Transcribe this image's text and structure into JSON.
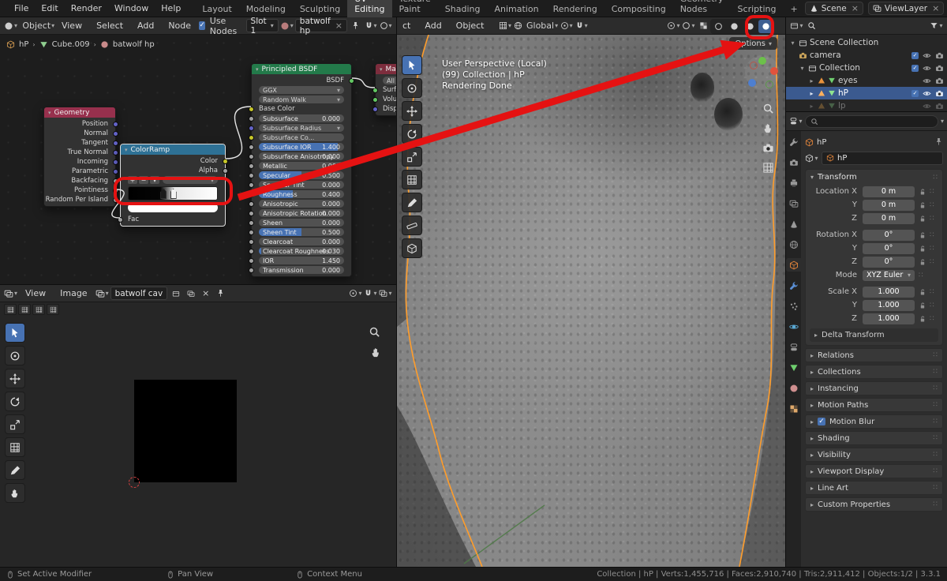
{
  "topbar": {
    "menus": [
      "File",
      "Edit",
      "Render",
      "Window",
      "Help"
    ],
    "workspaces": [
      "Layout",
      "Modeling",
      "Sculpting",
      "UV Editing",
      "Texture Paint",
      "Shading",
      "Animation",
      "Rendering",
      "Compositing",
      "Geometry Nodes",
      "Scripting"
    ],
    "add_tab": "+",
    "scene": "Scene",
    "viewlayer": "ViewLayer"
  },
  "shader": {
    "mode": "Object",
    "menus": [
      "View",
      "Select",
      "Add",
      "Node"
    ],
    "use_nodes": "Use Nodes",
    "slot": "Slot 1",
    "material": "batwolf hp",
    "breadcrumb": [
      "hP",
      "Cube.009",
      "batwolf hp"
    ],
    "geometry": {
      "title": "Geometry",
      "outputs": [
        "Position",
        "Normal",
        "Tangent",
        "True Normal",
        "Incoming",
        "Parametric",
        "Backfacing",
        "Pointiness",
        "Random Per Island"
      ]
    },
    "colorramp": {
      "title": "ColorRamp",
      "outputs": [
        "Color",
        "Alpha"
      ],
      "input": "Fac"
    },
    "principled": {
      "title": "Principled BSDF",
      "output": "BSDF",
      "dd1": "GGX",
      "dd2": "Random Walk",
      "base": "Base Color",
      "rows": [
        {
          "label": "Subsurface",
          "value": "0.000"
        },
        {
          "label": "Subsurface Radius",
          "value": ""
        },
        {
          "label": "Subsurface Co...",
          "value": ""
        },
        {
          "label": "Subsurface IOR",
          "value": "1.400"
        },
        {
          "label": "Subsurface Anisotropy",
          "value": "0.000"
        },
        {
          "label": "Metallic",
          "value": "0.000"
        },
        {
          "label": "Specular",
          "value": "0.500"
        },
        {
          "label": "Specular Tint",
          "value": "0.000"
        },
        {
          "label": "Roughness",
          "value": "0.400"
        },
        {
          "label": "Anisotropic",
          "value": "0.000"
        },
        {
          "label": "Anisotropic Rotation",
          "value": "0.000"
        },
        {
          "label": "Sheen",
          "value": "0.000"
        },
        {
          "label": "Sheen Tint",
          "value": "0.500"
        },
        {
          "label": "Clearcoat",
          "value": "0.000"
        },
        {
          "label": "Clearcoat Roughness",
          "value": "0.030"
        },
        {
          "label": "IOR",
          "value": "1.450"
        },
        {
          "label": "Transmission",
          "value": "0.000"
        }
      ]
    },
    "material_output": {
      "title": "Ma...",
      "rows": [
        "All",
        "Surface",
        "Volume",
        "Displ..."
      ]
    }
  },
  "viewport": {
    "menus": [
      "ct",
      "Add",
      "Object"
    ],
    "orientation": "Global",
    "options": "Options",
    "overlay_lines": [
      "User Perspective (Local)",
      "(99) Collection | hP",
      "Rendering Done"
    ]
  },
  "uv": {
    "menus": [
      "View",
      "Image"
    ],
    "image": "batwolf cav"
  },
  "outliner": {
    "rows": [
      "Scene Collection",
      "camera",
      "Collection",
      "eyes",
      "hP",
      "lp"
    ]
  },
  "properties": {
    "name": "hP",
    "object": "hP",
    "transform": {
      "title": "Transform",
      "rows": [
        {
          "label": "Location X",
          "value": "0 m"
        },
        {
          "label": "Y",
          "value": "0 m"
        },
        {
          "label": "Z",
          "value": "0 m"
        },
        {
          "label": "Rotation X",
          "value": "0°"
        },
        {
          "label": "Y",
          "value": "0°"
        },
        {
          "label": "Z",
          "value": "0°"
        },
        {
          "label": "Mode",
          "value": "XYZ Euler"
        },
        {
          "label": "Scale X",
          "value": "1.000"
        },
        {
          "label": "Y",
          "value": "1.000"
        },
        {
          "label": "Z",
          "value": "1.000"
        }
      ],
      "delta": "Delta Transform"
    },
    "panels": [
      "Relations",
      "Collections",
      "Instancing",
      "Motion Paths",
      "Motion Blur",
      "Shading",
      "Visibility",
      "Viewport Display",
      "Line Art",
      "Custom Properties"
    ]
  },
  "statusbar": {
    "items": [
      "Set Active Modifier",
      "Pan View",
      "Context Menu"
    ],
    "stats": "Collection | hP | Verts:1,455,716 | Faces:2,910,740 | Tris:2,911,412 | Objects:1/2 | 3.3.1"
  }
}
